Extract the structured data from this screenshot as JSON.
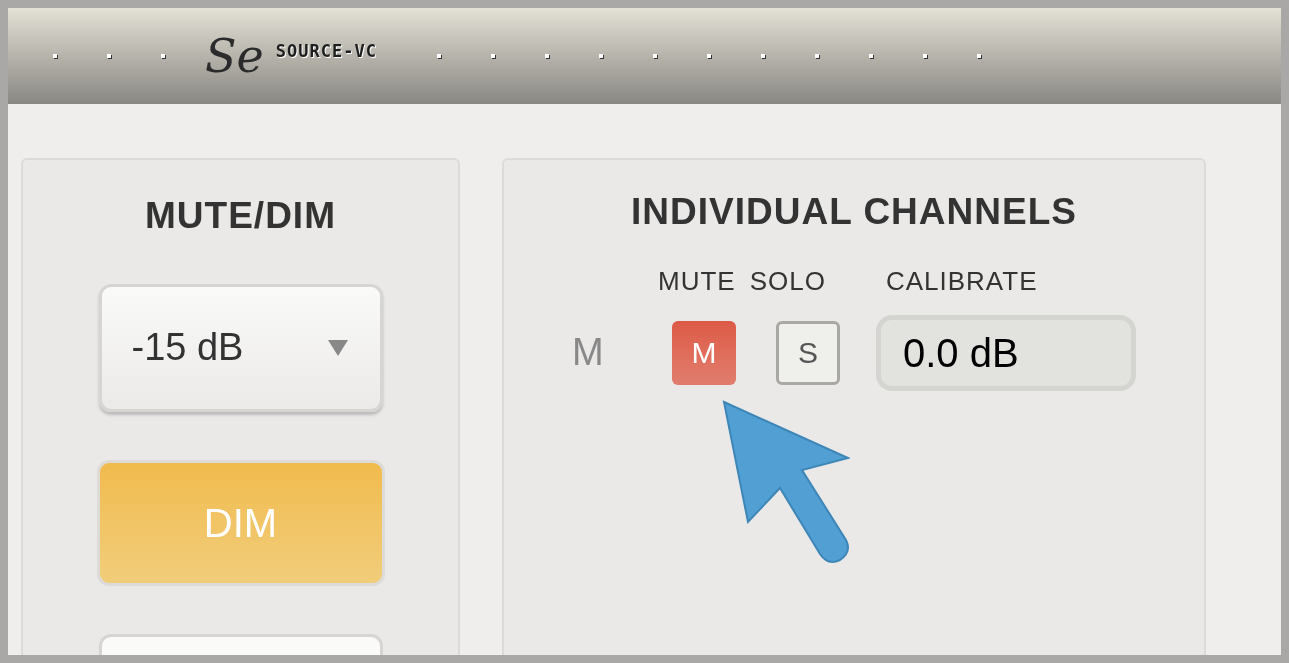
{
  "header": {
    "logo": "Se",
    "product": "SOURCE-VC"
  },
  "mute_dim": {
    "title": "MUTE/DIM",
    "dim_level": "-15 dB",
    "dim_button": {
      "label": "DIM",
      "on": true
    }
  },
  "channels": {
    "title": "INDIVIDUAL CHANNELS",
    "columns": [
      "MUTE",
      "SOLO",
      "CALIBRATE"
    ],
    "rows": [
      {
        "name": "M",
        "mute": {
          "label": "M",
          "selected": true
        },
        "solo": {
          "label": "S",
          "selected": false
        },
        "calibrate": "0.0 dB"
      }
    ]
  }
}
